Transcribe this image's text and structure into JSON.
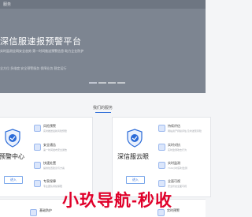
{
  "hero": {
    "topbar_text": "服务",
    "title": "深信服速报预警平台",
    "subtitle": "实时监测全网安全态势 第一时间推送预警信息 助力企业防护",
    "subtitle2": "全方位 多维度 安全预警服务 保障业务 稳定运行"
  },
  "carousel": {
    "count": 4,
    "active_index": 0
  },
  "services_section": {
    "title": "我们的服务"
  },
  "cards": [
    {
      "title": "预警中心",
      "button": "进入",
      "features": [
        {
          "title": "风险预警",
          "desc": "实时推送最新风险预警"
        },
        {
          "title": "安全通告",
          "desc": "第一时间发布安全通告"
        },
        {
          "title": "快速处置",
          "desc": "提供处置建议与方案"
        },
        {
          "title": "专家保障",
          "desc": "专业团队持续保障"
        }
      ]
    },
    {
      "title": "深信服云眼",
      "button": "进入",
      "features": [
        {
          "title": "持续评估",
          "desc": "网站资产持续评估 及时发现风险"
        },
        {
          "title": "实时对抗",
          "desc": "实时监测攻击行为"
        },
        {
          "title": "实时监测",
          "desc": "7×24小时实时监测"
        },
        {
          "title": "全面可视",
          "desc": "安全状态全面可视"
        }
      ]
    }
  ],
  "bottom": {
    "left_label": "基础防护",
    "right_label": "实时预警"
  },
  "overlay_text": "小玖导航-秒收",
  "colors": {
    "accent": "#2b6bd8",
    "overlay": "#e0002a",
    "hero_bg": "#7d8591"
  }
}
